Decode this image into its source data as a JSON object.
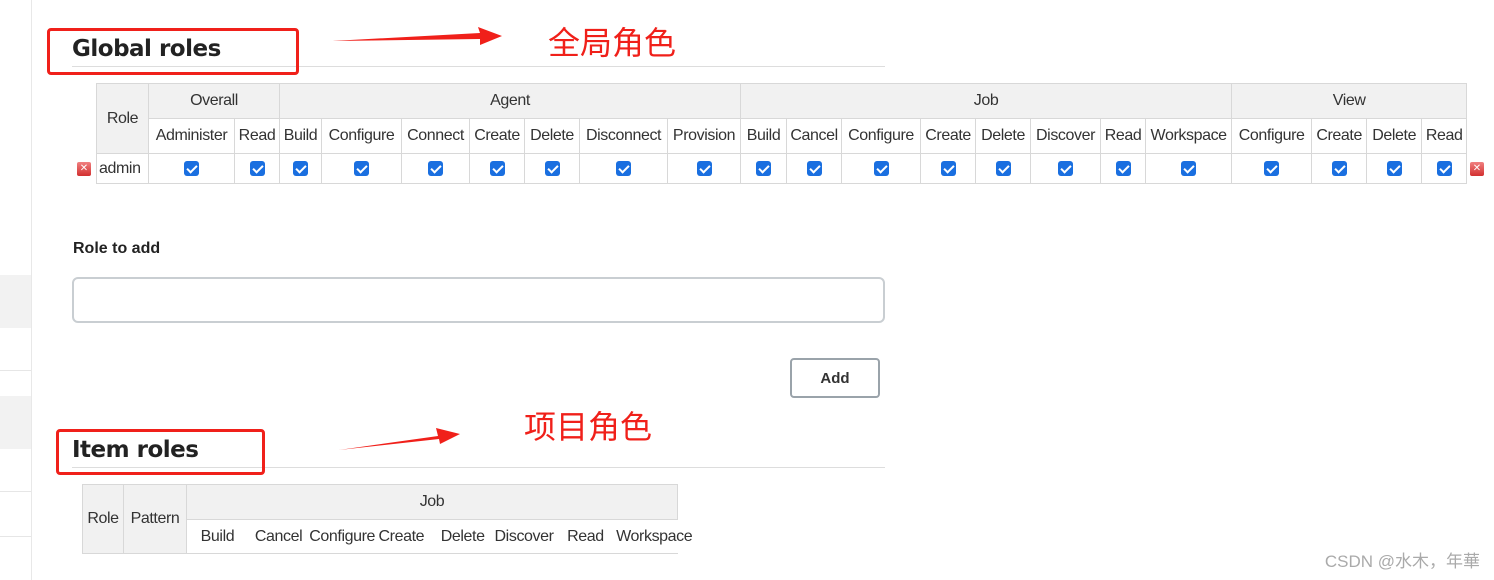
{
  "global_roles": {
    "title": "Global roles",
    "role_header": "Role",
    "groups": [
      {
        "name": "Overall",
        "permissions": [
          "Administer",
          "Read"
        ]
      },
      {
        "name": "Agent",
        "permissions": [
          "Build",
          "Configure",
          "Connect",
          "Create",
          "Delete",
          "Disconnect",
          "Provision"
        ]
      },
      {
        "name": "Job",
        "permissions": [
          "Build",
          "Cancel",
          "Configure",
          "Create",
          "Delete",
          "Discover",
          "Read",
          "Workspace"
        ]
      },
      {
        "name": "View",
        "permissions": [
          "Configure",
          "Create",
          "Delete",
          "Read"
        ]
      }
    ],
    "rows": [
      {
        "role": "admin",
        "checked": [
          true,
          true,
          true,
          true,
          true,
          true,
          true,
          true,
          true,
          true,
          true,
          true,
          true,
          true,
          true,
          true,
          true,
          true,
          true,
          true,
          true
        ]
      }
    ]
  },
  "role_to_add": {
    "label": "Role to add",
    "value": "",
    "add_label": "Add"
  },
  "item_roles": {
    "title": "Item roles",
    "role_header": "Role",
    "pattern_header": "Pattern",
    "groups": [
      {
        "name": "Job",
        "permissions": [
          "Build",
          "Cancel",
          "Configure",
          "Create",
          "Delete",
          "Discover",
          "Read",
          "Workspace"
        ]
      }
    ]
  },
  "annotations": {
    "global": "全局角色",
    "item": "项目角色",
    "color": "#f0201a"
  },
  "watermark": "CSDN @水木，年華",
  "colors": {
    "checkbox": "#1a6fe0",
    "header_bg": "#f1f1f1"
  }
}
